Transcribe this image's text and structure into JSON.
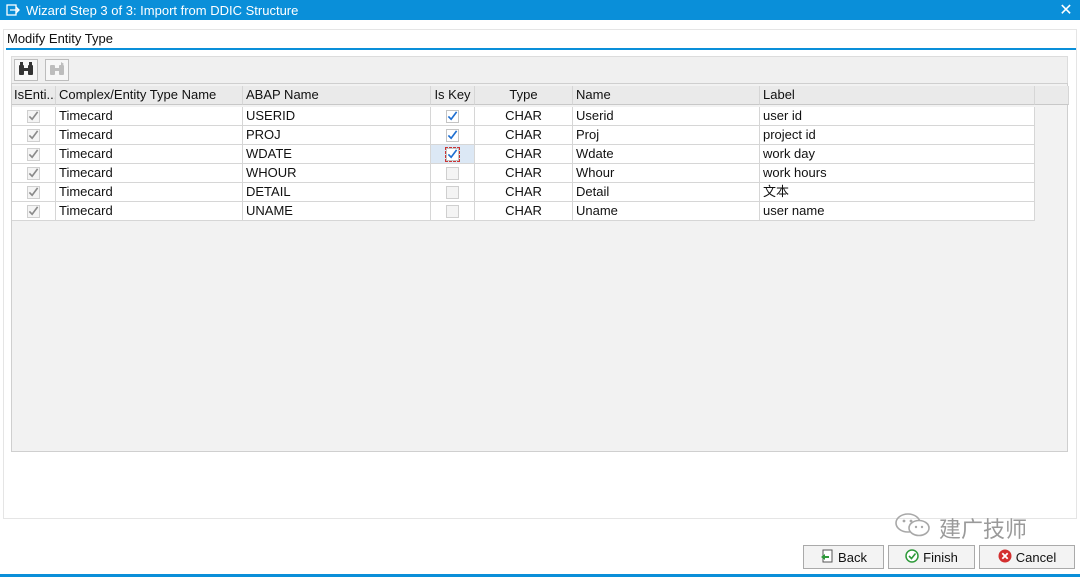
{
  "window": {
    "title": "Wizard Step 3 of 3: Import from DDIC Structure",
    "close_glyph": "✕"
  },
  "section": {
    "title": "Modify Entity Type"
  },
  "toolbar": {
    "buttons": [
      {
        "icon": "find-icon",
        "enabled": true
      },
      {
        "icon": "find-next-icon",
        "enabled": false
      }
    ]
  },
  "table": {
    "columns": {
      "isentity": "IsEnti...",
      "complex": "Complex/Entity Type Name",
      "abap": "ABAP Name",
      "iskey": "Is Key",
      "type": "Type",
      "name": "Name",
      "label": "Label"
    },
    "rows": [
      {
        "isentity": true,
        "complex": "Timecard",
        "abap": "USERID",
        "iskey": true,
        "type": "CHAR",
        "name": "Userid",
        "label": "user id"
      },
      {
        "isentity": true,
        "complex": "Timecard",
        "abap": "PROJ",
        "iskey": true,
        "type": "CHAR",
        "name": "Proj",
        "label": "project id"
      },
      {
        "isentity": true,
        "complex": "Timecard",
        "abap": "WDATE",
        "iskey": true,
        "type": "CHAR",
        "name": "Wdate",
        "label": "work day"
      },
      {
        "isentity": true,
        "complex": "Timecard",
        "abap": "WHOUR",
        "iskey": false,
        "type": "CHAR",
        "name": "Whour",
        "label": "work hours"
      },
      {
        "isentity": true,
        "complex": "Timecard",
        "abap": "DETAIL",
        "iskey": false,
        "type": "CHAR",
        "name": "Detail",
        "label": "文本"
      },
      {
        "isentity": true,
        "complex": "Timecard",
        "abap": "UNAME",
        "iskey": false,
        "type": "CHAR",
        "name": "Uname",
        "label": "user name"
      }
    ]
  },
  "footer": {
    "back_label": "Back",
    "finish_label": "Finish",
    "cancel_label": "Cancel"
  },
  "watermark": {
    "text": "建广技师"
  },
  "colors": {
    "accent": "#0a8fd9",
    "check_blue": "#1f6fd1",
    "check_gray": "#8a8a8a",
    "cancel_red": "#d32f2f",
    "finish_green": "#2e9a3a"
  }
}
